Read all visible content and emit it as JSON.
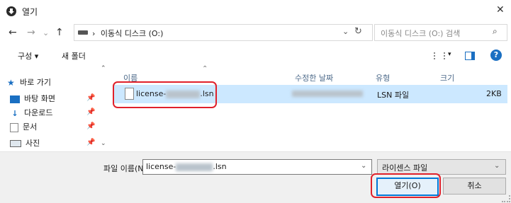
{
  "window": {
    "title": "열기",
    "close_glyph": "✕"
  },
  "nav": {
    "back": "←",
    "forward": "→",
    "recent": "⌄",
    "up": "↑"
  },
  "address": {
    "separator": "›",
    "location": "이동식 디스크 (O:)",
    "dropdown": "⌄",
    "refresh": "↻"
  },
  "search": {
    "placeholder": "이동식 디스크 (O:) 검색",
    "icon": "⌕"
  },
  "toolbar": {
    "organize": "구성 ▾",
    "new_folder": "새 폴더",
    "view_dropdown": "▾",
    "help": "?"
  },
  "sidebar": {
    "items": [
      {
        "label": "바로 가기",
        "icon": "star-icon",
        "pin": ""
      },
      {
        "label": "바탕 화면",
        "icon": "desktop-icon",
        "pin": "📌"
      },
      {
        "label": "다운로드",
        "icon": "download-icon",
        "pin": "📌"
      },
      {
        "label": "문서",
        "icon": "document-icon",
        "pin": "📌"
      },
      {
        "label": "사진",
        "icon": "pictures-icon",
        "pin": "📌"
      }
    ],
    "scroll_up": "⌃",
    "scroll_down": "⌄"
  },
  "columns": {
    "name": "이름",
    "modified": "수정한 날짜",
    "type": "유형",
    "size": "크기",
    "sort_glyph": "⌃"
  },
  "files": [
    {
      "name_prefix": "license-",
      "name_suffix": ".lsn",
      "type": "LSN 파일",
      "size": "2KB"
    }
  ],
  "footer": {
    "filename_label": "파일 이름(N):",
    "filename_prefix": "license-",
    "filename_suffix": ".lsn",
    "filename_dropdown": "⌄",
    "filetype": "라이센스 파일",
    "filetype_dropdown": "⌄",
    "open_label": "열기(O)",
    "cancel_label": "취소"
  },
  "colors": {
    "accent": "#0078d7",
    "highlight": "#e0212b",
    "selection": "#cce8ff"
  }
}
